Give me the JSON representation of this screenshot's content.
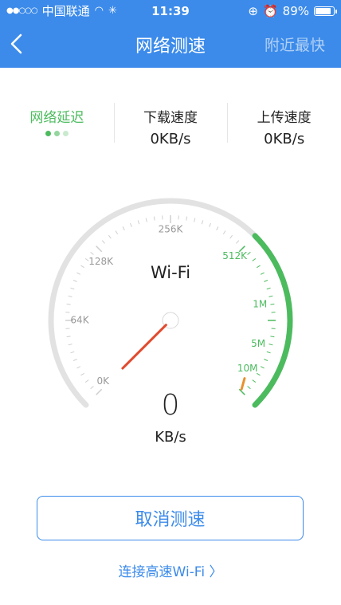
{
  "status": {
    "carrier": "中国联通",
    "time": "11:39",
    "battery": "89%",
    "battery_fraction": 0.89,
    "signal_icon": "signal-dots",
    "wifi_icon": "wifi-icon",
    "loading_icon": "activity-spinner-icon",
    "lock_icon": "rotation-lock-icon",
    "alarm_icon": "alarm-icon"
  },
  "nav": {
    "title": "网络测速",
    "right": "附近最快",
    "back_icon": "chevron-left-icon"
  },
  "metrics": {
    "latency": {
      "label": "网络延迟"
    },
    "download": {
      "label": "下载速度",
      "value": "0KB/s"
    },
    "upload": {
      "label": "上传速度",
      "value": "0KB/s"
    }
  },
  "gauge": {
    "network": "Wi-Fi",
    "value": "0",
    "unit": "KB/s",
    "ticks": [
      "0K",
      "64K",
      "128K",
      "256K",
      "512K",
      "1M",
      "5M",
      "10M"
    ],
    "colors": {
      "track": "#e2e2e2",
      "progress": "#4cbb5e",
      "needle": "#e04a2e"
    }
  },
  "actions": {
    "cancel": "取消测速",
    "connect": "连接高速Wi-Fi",
    "connect_icon": "chevron-right-icon"
  }
}
